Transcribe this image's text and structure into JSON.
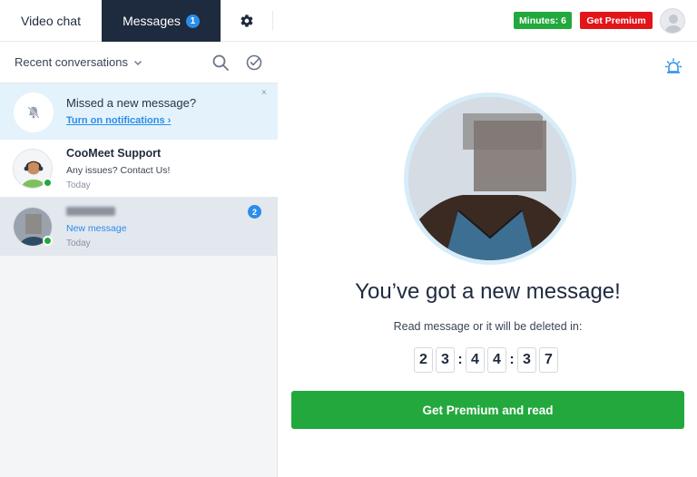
{
  "topbar": {
    "tabs": [
      {
        "label": "Video chat",
        "active": false
      },
      {
        "label": "Messages",
        "active": true,
        "badge": "1"
      }
    ],
    "minutes_label": "Minutes: 6",
    "premium_label": "Get Premium",
    "colors": {
      "active_tab": "#1e2a3d",
      "minutes": "#22a83c",
      "premium": "#e2151a",
      "accent": "#2b8dea"
    }
  },
  "sidebar": {
    "title": "Recent conversations",
    "notification": {
      "title": "Missed a new message?",
      "link": "Turn on notifications",
      "link_arrow": "›",
      "close": "×"
    },
    "conversations": [
      {
        "name": "CooMeet Support",
        "line": "Any issues? Contact Us!",
        "time": "Today",
        "online": true
      },
      {
        "name": "",
        "line": "New message",
        "time": "Today",
        "badge": "2",
        "online": true,
        "selected": true
      }
    ]
  },
  "main": {
    "headline": "You’ve got a new message!",
    "subline": "Read message or it will be deleted in:",
    "timer": {
      "digits": [
        "2",
        "3",
        "4",
        "4",
        "3",
        "7"
      ],
      "separator": ":"
    },
    "cta": "Get Premium and read"
  }
}
